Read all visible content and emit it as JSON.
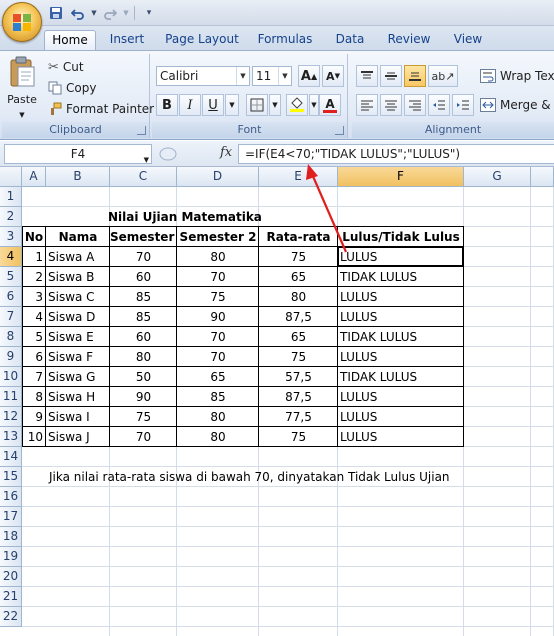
{
  "qat": {
    "save_icon": "save-icon",
    "undo_icon": "undo-icon",
    "redo_icon": "redo-icon"
  },
  "tabs": [
    "Home",
    "Insert",
    "Page Layout",
    "Formulas",
    "Data",
    "Review",
    "View"
  ],
  "ribbon": {
    "clipboard": {
      "label": "Clipboard",
      "paste": "Paste",
      "cut": "Cut",
      "copy": "Copy",
      "format_painter": "Format Painter"
    },
    "font": {
      "label": "Font",
      "font_name": "Calibri",
      "font_size": "11",
      "bold": "B",
      "italic": "I",
      "underline": "U",
      "grow": "A",
      "shrink": "A"
    },
    "alignment": {
      "label": "Alignment",
      "wrap_text": "Wrap Text",
      "merge": "Merge & C"
    }
  },
  "formula_bar": {
    "name_box": "F4",
    "fx": "fx",
    "formula": "=IF(E4<70;\"TIDAK LULUS\";\"LULUS\")"
  },
  "columns": [
    "A",
    "B",
    "C",
    "D",
    "E",
    "F",
    "G"
  ],
  "rows": [
    "1",
    "2",
    "3",
    "4",
    "5",
    "6",
    "7",
    "8",
    "9",
    "10",
    "11",
    "12",
    "13",
    "14",
    "15",
    "16",
    "17",
    "18",
    "19",
    "20",
    "21",
    "22"
  ],
  "sheet": {
    "title": "Nilai Ujian Matematika",
    "headers": [
      "No",
      "Nama",
      "Semester 1",
      "Semester 2",
      "Rata-rata",
      "Lulus/Tidak Lulus"
    ],
    "rows": [
      [
        "1",
        "Siswa A",
        "70",
        "80",
        "75",
        "LULUS"
      ],
      [
        "2",
        "Siswa B",
        "60",
        "70",
        "65",
        "TIDAK LULUS"
      ],
      [
        "3",
        "Siswa C",
        "85",
        "75",
        "80",
        "LULUS"
      ],
      [
        "4",
        "Siswa D",
        "85",
        "90",
        "87,5",
        "LULUS"
      ],
      [
        "5",
        "Siswa E",
        "60",
        "70",
        "65",
        "TIDAK LULUS"
      ],
      [
        "6",
        "Siswa F",
        "80",
        "70",
        "75",
        "LULUS"
      ],
      [
        "7",
        "Siswa G",
        "50",
        "65",
        "57,5",
        "TIDAK LULUS"
      ],
      [
        "8",
        "Siswa H",
        "90",
        "85",
        "87,5",
        "LULUS"
      ],
      [
        "9",
        "Siswa I",
        "75",
        "80",
        "77,5",
        "LULUS"
      ],
      [
        "10",
        "Siswa J",
        "70",
        "80",
        "75",
        "LULUS"
      ]
    ],
    "note": "Jika nilai rata-rata siswa di bawah 70, dinyatakan Tidak Lulus Ujian"
  },
  "colors": {
    "ribbon_text": "#15428b",
    "selected_header": "#f1c15f",
    "annotation_arrow": "#e0201f"
  }
}
